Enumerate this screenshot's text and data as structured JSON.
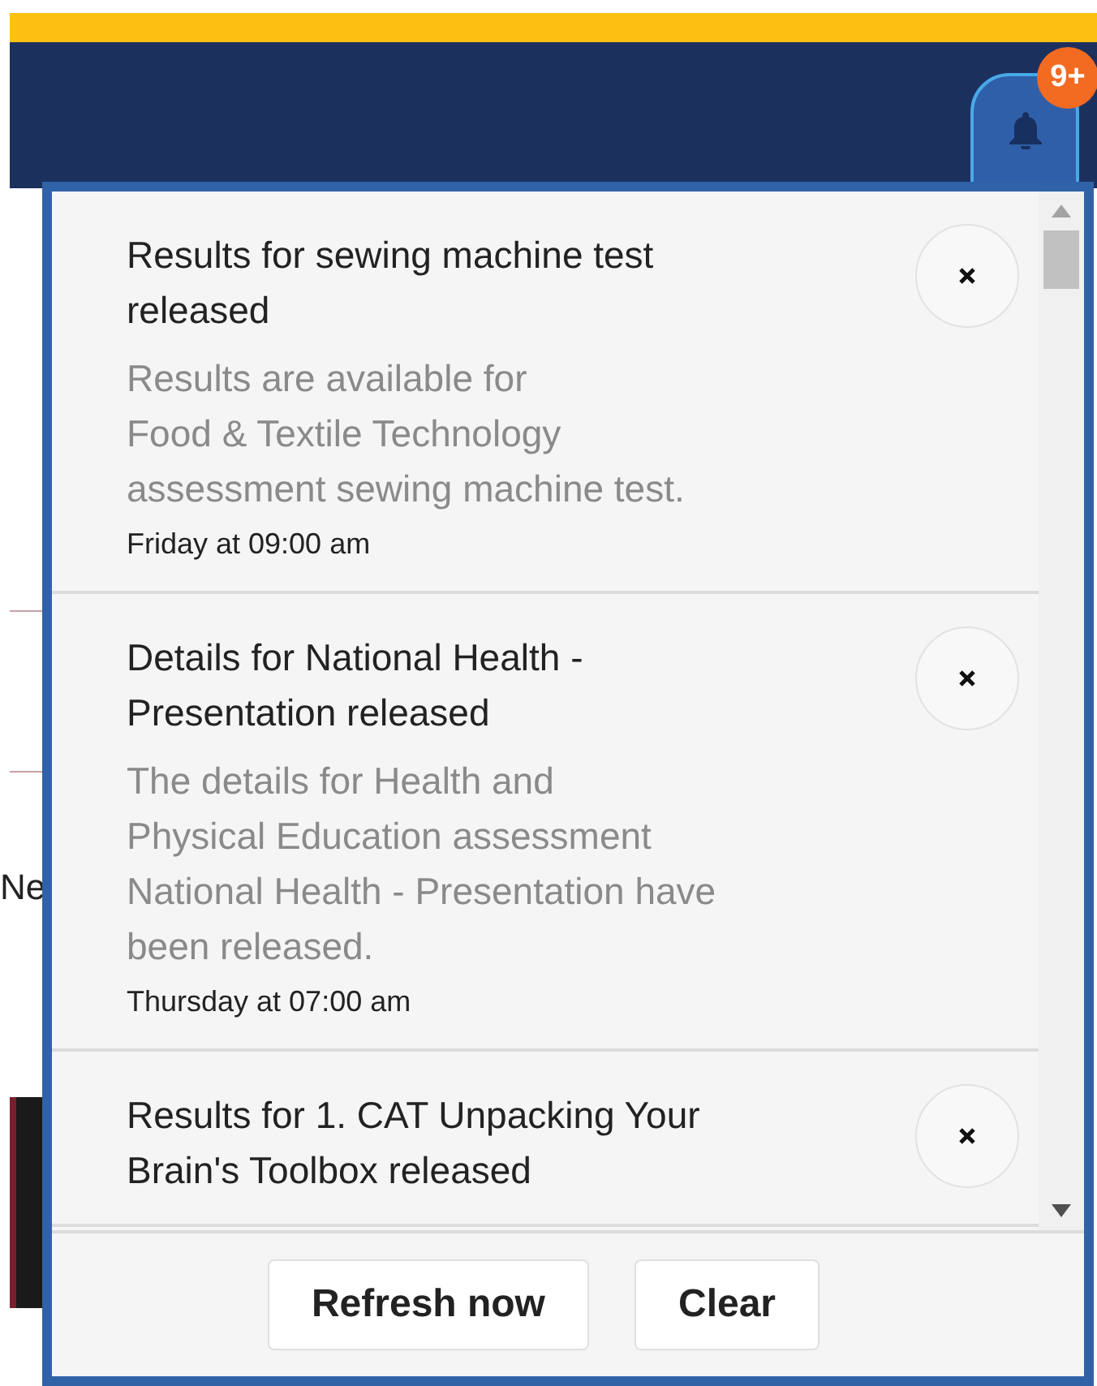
{
  "header": {
    "badge": "9+"
  },
  "background": {
    "side_text": "Ne"
  },
  "notifications": [
    {
      "title": "Results for sewing machine test\nreleased",
      "body": "Results are available for\nFood & Textile Technology\nassessment sewing machine test.",
      "time": "Friday at 09:00 am"
    },
    {
      "title": "Details for National Health -\nPresentation released",
      "body": "The details for              Health and\nPhysical Education assessment\nNational Health - Presentation have\nbeen released.",
      "time": "Thursday at 07:00 am"
    },
    {
      "title": "Results for 1. CAT Unpacking Your\nBrain's Toolbox released"
    }
  ],
  "buttons": [
    "Refresh now",
    "Clear"
  ]
}
